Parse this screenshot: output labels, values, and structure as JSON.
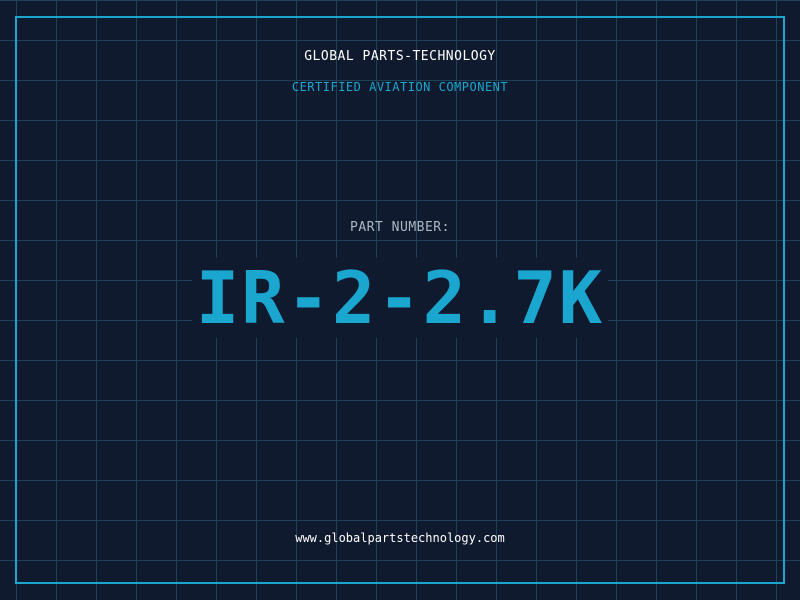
{
  "header": {
    "company": "GLOBAL PARTS-TECHNOLOGY",
    "tagline": "CERTIFIED AVIATION COMPONENT"
  },
  "part": {
    "label": "PART NUMBER:",
    "number": "IR-2-2.7K"
  },
  "footer": {
    "website": "www.globalpartstechnology.com"
  },
  "colors": {
    "background": "#0f1a2e",
    "grid": "#1e4257",
    "accent": "#1aa6cf",
    "text": "#ffffff",
    "muted": "#aeb8c4"
  }
}
